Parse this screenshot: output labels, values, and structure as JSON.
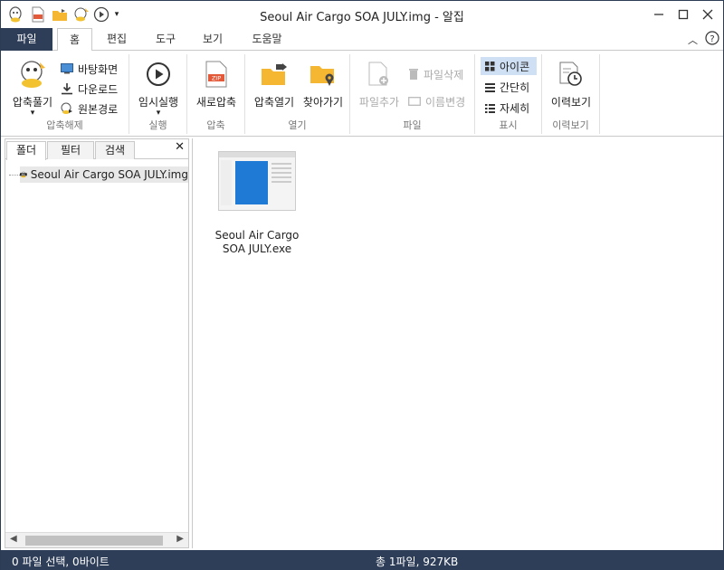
{
  "window": {
    "title": "Seoul Air Cargo SOA JULY.img - 알집"
  },
  "tabs": [
    {
      "label": "파일"
    },
    {
      "label": "홈"
    },
    {
      "label": "편집"
    },
    {
      "label": "도구"
    },
    {
      "label": "보기"
    },
    {
      "label": "도움말"
    }
  ],
  "ribbon": {
    "extract": {
      "big_label": "압축풀기",
      "desktop": "바탕화면",
      "downloads": "다운로드",
      "original_path": "원본경로",
      "group_label": "압축해제"
    },
    "run": {
      "big_label": "임시실행",
      "group_label": "실행"
    },
    "compress": {
      "big_label": "새로압축",
      "group_label": "압축"
    },
    "open": {
      "open_archive": "압축열기",
      "browse": "찾아가기",
      "group_label": "열기"
    },
    "file": {
      "add": "파일추가",
      "delete": "파일삭제",
      "rename": "이름변경",
      "group_label": "파일"
    },
    "view": {
      "icon": "아이콘",
      "simple": "간단히",
      "detail": "자세히",
      "group_label": "표시"
    },
    "history": {
      "big_label": "이력보기",
      "group_label": "이력보기"
    }
  },
  "left_pane": {
    "tabs": [
      "폴더",
      "필터",
      "검색"
    ],
    "tree_item": "Seoul Air Cargo SOA JULY.img"
  },
  "main_pane": {
    "file": {
      "name": "Seoul Air Cargo SOA JULY.exe"
    }
  },
  "status": {
    "left": "0 파일 선택,  0바이트",
    "center": "총 1파일,  927KB"
  },
  "colors": {
    "accent": "#2e3e58",
    "selection": "#cfe0f5",
    "folder": "#f5b731",
    "zip_red": "#e35a3a"
  }
}
